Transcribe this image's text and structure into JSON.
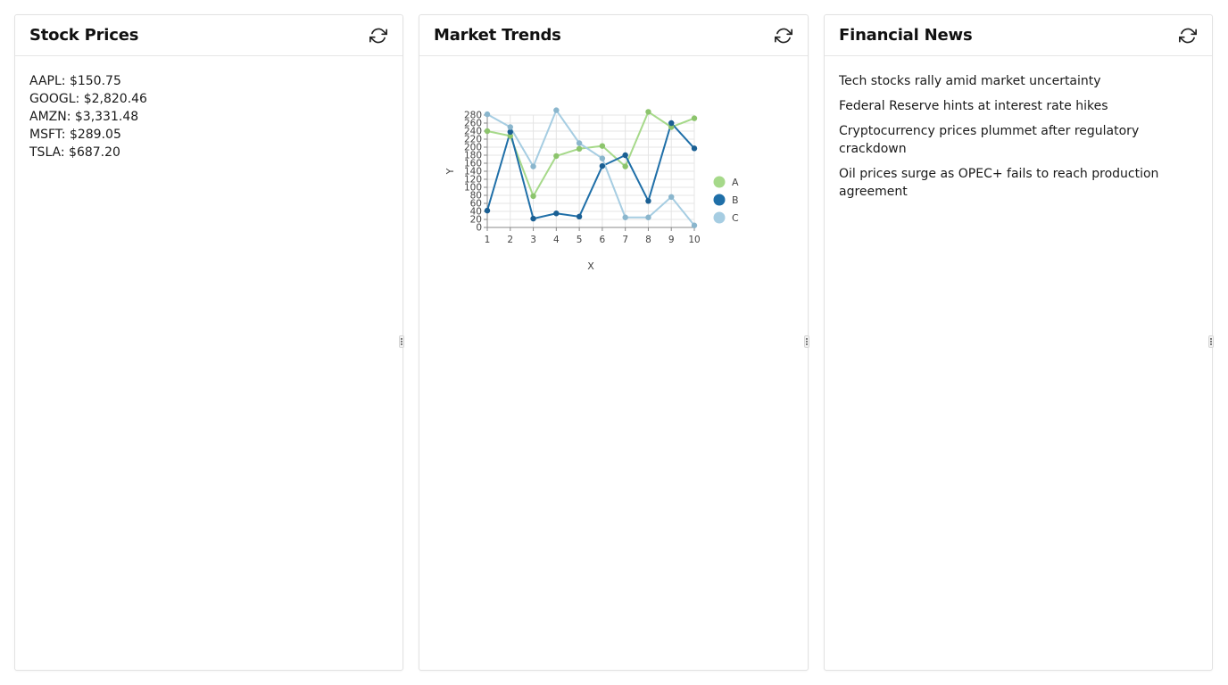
{
  "panels": {
    "stocks": {
      "title": "Stock Prices",
      "refresh_icon": "refresh-icon",
      "items": [
        "AAPL: $150.75",
        "GOOGL: $2,820.46",
        "AMZN: $3,331.48",
        "MSFT: $289.05",
        "TSLA: $687.20"
      ]
    },
    "trends": {
      "title": "Market Trends",
      "refresh_icon": "refresh-icon"
    },
    "news": {
      "title": "Financial News",
      "refresh_icon": "refresh-icon",
      "items": [
        "Tech stocks rally amid market uncertainty",
        "Federal Reserve hints at interest rate hikes",
        "Cryptocurrency prices plummet after regulatory crackdown",
        "Oil prices surge as OPEC+ fails to reach production agreement"
      ]
    }
  },
  "colors": {
    "series_a": "#a6d98a",
    "series_b": "#1f6fa8",
    "series_c": "#a6cde2",
    "grid": "#e4e4e4"
  },
  "chart_data": {
    "type": "line",
    "xlabel": "X",
    "ylabel": "Y",
    "x": [
      1,
      2,
      3,
      4,
      5,
      6,
      7,
      8,
      9,
      10
    ],
    "ylim": [
      0,
      280
    ],
    "yticks": [
      0,
      20,
      40,
      60,
      80,
      100,
      120,
      140,
      160,
      180,
      200,
      220,
      240,
      260,
      280
    ],
    "grid": true,
    "legend": "right",
    "series": [
      {
        "name": "A",
        "values": [
          240,
          228,
          78,
          178,
          196,
          203,
          152,
          288,
          250,
          272
        ]
      },
      {
        "name": "B",
        "values": [
          42,
          238,
          22,
          35,
          27,
          153,
          180,
          66,
          260,
          197
        ]
      },
      {
        "name": "C",
        "values": [
          282,
          250,
          152,
          292,
          210,
          172,
          25,
          25,
          76,
          5
        ]
      }
    ]
  }
}
